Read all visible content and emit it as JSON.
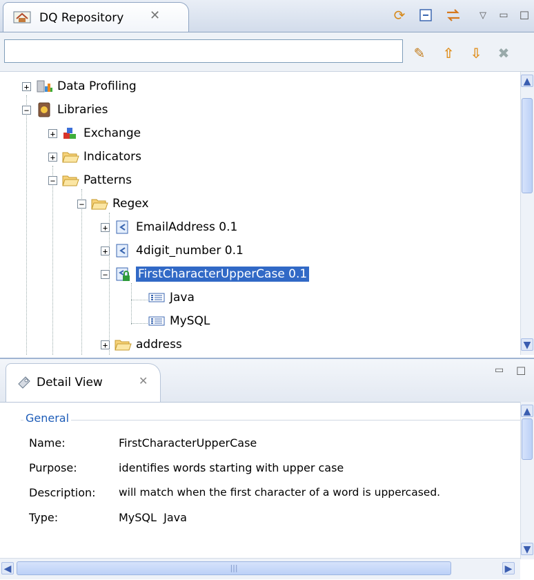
{
  "repo_view": {
    "tab_title": "DQ Repository",
    "filter_value": "",
    "tree": [
      {
        "label": "Data Profiling",
        "icon": "data-profiling-icon",
        "expander": "+"
      },
      {
        "label": "Libraries",
        "icon": "libraries-icon",
        "expander": "−"
      },
      {
        "label": "Exchange",
        "icon": "exchange-icon",
        "expander": "+"
      },
      {
        "label": "Indicators",
        "icon": "folder-icon",
        "expander": "+"
      },
      {
        "label": "Patterns",
        "icon": "folder-icon",
        "expander": "−"
      },
      {
        "label": "Regex",
        "icon": "folder-icon",
        "expander": "−"
      },
      {
        "label": "EmailAddress 0.1",
        "icon": "regex-pattern-icon",
        "expander": "+"
      },
      {
        "label": "4digit_number 0.1",
        "icon": "regex-pattern-icon",
        "expander": "+"
      },
      {
        "label": "FirstCharacterUpperCase 0.1",
        "icon": "locked-pattern-icon",
        "expander": "−"
      },
      {
        "label": "Java",
        "icon": "expression-icon"
      },
      {
        "label": "MySQL",
        "icon": "expression-icon"
      },
      {
        "label": "address",
        "icon": "folder-icon",
        "expander": "+"
      }
    ]
  },
  "detail_view": {
    "tab_title": "Detail View",
    "group_title": "General",
    "fields": [
      {
        "label": "Name:",
        "value": "FirstCharacterUpperCase"
      },
      {
        "label": "Purpose:",
        "value": "identifies words starting with upper case"
      },
      {
        "label": "Description:",
        "value": "will match when the first character of a word is uppercased."
      },
      {
        "label": "Type:",
        "value": "MySQL  Java"
      }
    ]
  },
  "colors": {
    "selection": "#3169c6",
    "group_title": "#1d5cb8"
  }
}
